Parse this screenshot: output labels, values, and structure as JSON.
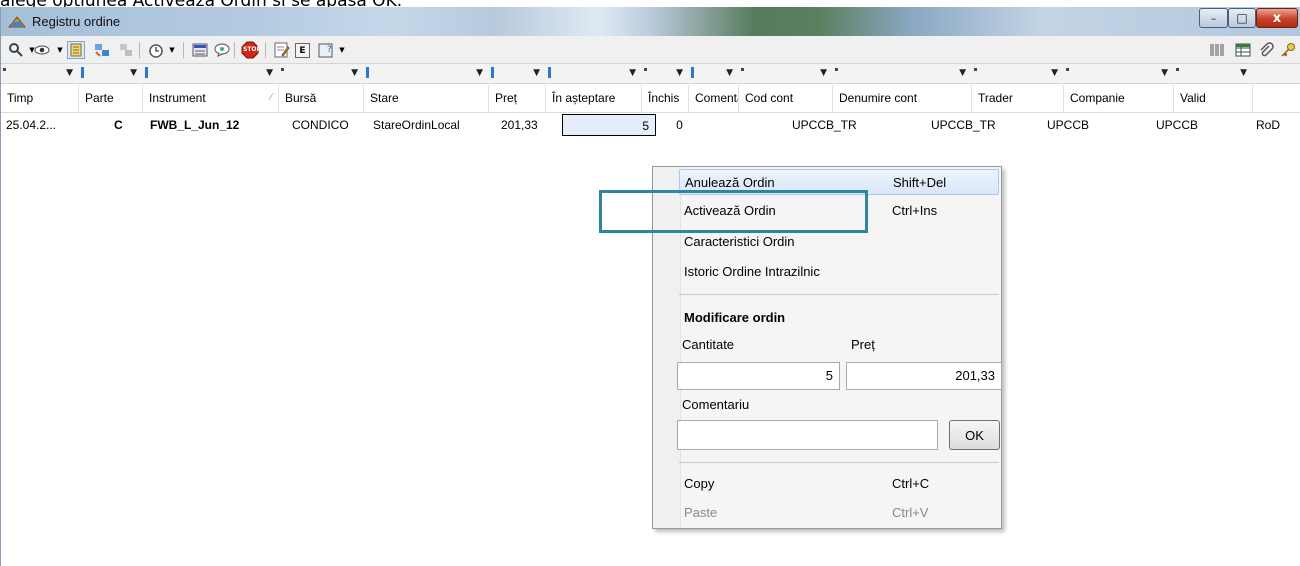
{
  "caption_fragment": "alege opțiunea Activează Ordin și se apasă OK.",
  "window": {
    "title": "Registru ordine",
    "buttons": {
      "minimize": "–",
      "maximize": "□",
      "close": "x"
    }
  },
  "toolbar": {
    "left_icons": [
      "search-icon",
      "eye-icon",
      "order-book-icon",
      "transfer-icon",
      "inactive-transfer-icon",
      "clock-icon",
      "list-icon",
      "chat-icon",
      "stop-icon",
      "edit-icon",
      "exchange-icon",
      "help-icon"
    ],
    "right_icons": [
      "barcode-icon",
      "table-icon",
      "attach-icon",
      "key-icon"
    ],
    "stop_label": "STOP",
    "exchange_label": "E"
  },
  "columns": [
    {
      "label": "Timp",
      "w": 78
    },
    {
      "label": "Parte",
      "w": 64
    },
    {
      "label": "Instrument",
      "w": 136
    },
    {
      "label": "Bursă",
      "w": 85
    },
    {
      "label": "Stare",
      "w": 125
    },
    {
      "label": "Preț",
      "w": 57
    },
    {
      "label": "În așteptare",
      "w": 96
    },
    {
      "label": "Închis",
      "w": 47
    },
    {
      "label": "Comenta",
      "w": 50
    },
    {
      "label": "Cod cont",
      "w": 94
    },
    {
      "label": "Denumire cont",
      "w": 139
    },
    {
      "label": "Trader",
      "w": 92
    },
    {
      "label": "Companie",
      "w": 110
    },
    {
      "label": "Valid",
      "w": 79
    }
  ],
  "filters": [
    {
      "ind": "dot"
    },
    {
      "ind": "blue"
    },
    {
      "ind": "blue"
    },
    {
      "ind": "dot"
    },
    {
      "ind": "blue"
    },
    {
      "ind": "blue"
    },
    {
      "ind": "blue"
    },
    {
      "ind": "dot"
    },
    {
      "ind": "blue"
    },
    {
      "ind": "dot"
    },
    {
      "ind": "dot"
    },
    {
      "ind": "dot"
    },
    {
      "ind": "dot"
    },
    {
      "ind": "dot"
    }
  ],
  "row": {
    "timp": "25.04.2...",
    "parte": "C",
    "instrument": "FWB_L_Jun_12",
    "bursa": "CONDICO",
    "stare": "StareOrdinLocal",
    "pret": "201,33",
    "in_asteptare": "5",
    "inchis": "0",
    "comentariu": "",
    "cod_cont": "UPCCB_TR",
    "denumire_cont": "UPCCB_TR",
    "trader": "UPCCB",
    "companie": "UPCCB",
    "valid": "RoD"
  },
  "context_menu": {
    "items": [
      {
        "label": "Anulează Ordin",
        "shortcut": "Shift+Del"
      },
      {
        "label": "Activează Ordin",
        "shortcut": "Ctrl+Ins"
      },
      {
        "label": "Caracteristici Ordin",
        "shortcut": ""
      },
      {
        "label": "Istoric Ordine Intrazilnic",
        "shortcut": ""
      }
    ],
    "modify": {
      "title": "Modificare ordin",
      "quantity_label": "Cantitate",
      "quantity_value": "5",
      "price_label": "Preț",
      "price_value": "201,33",
      "comment_label": "Comentariu",
      "comment_value": "",
      "ok_label": "OK"
    },
    "copy": {
      "label": "Copy",
      "shortcut": "Ctrl+C"
    },
    "paste": {
      "label": "Paste",
      "shortcut": "Ctrl+V"
    }
  },
  "colors": {
    "callout": "#30869e",
    "selection_border": "#000000",
    "highlight": "#dae7f8"
  }
}
